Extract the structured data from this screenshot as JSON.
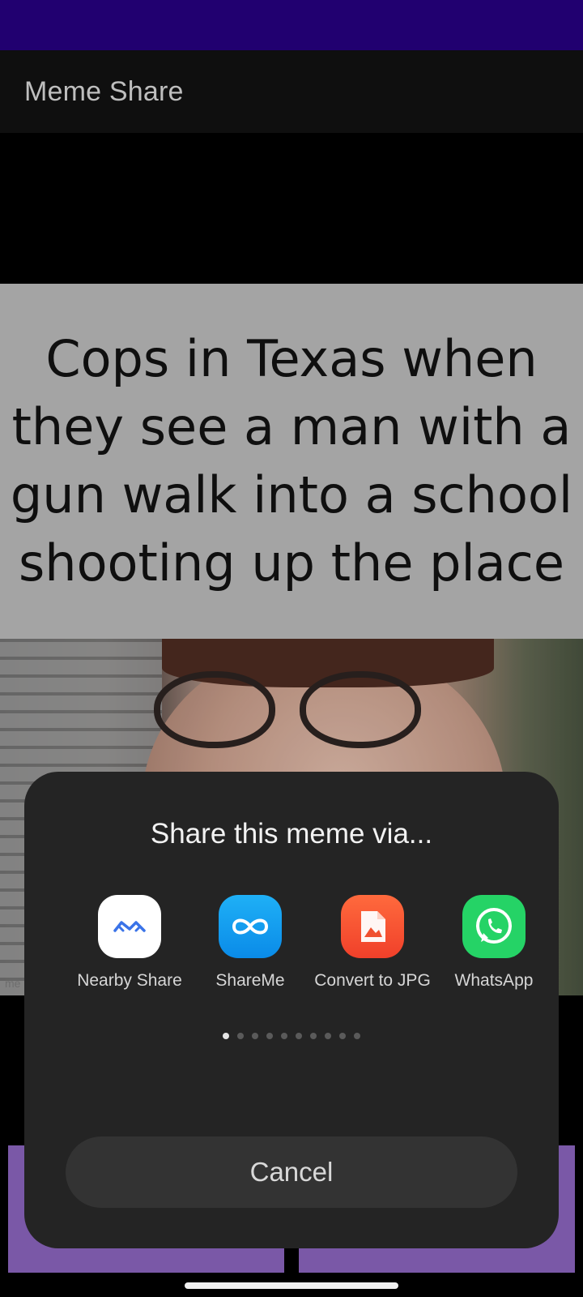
{
  "app": {
    "title": "Meme Share"
  },
  "meme": {
    "caption": "Cops in Texas when they see a man with a gun walk into a school shooting up the place",
    "watermark": "me"
  },
  "share_sheet": {
    "title": "Share this meme via...",
    "targets": [
      {
        "label": "Nearby Share",
        "icon": "nearby-share-icon",
        "color": "#ffffff"
      },
      {
        "label": "ShareMe",
        "icon": "shareme-icon",
        "color": "#1a9ff0"
      },
      {
        "label": "Convert to JPG",
        "icon": "convert-jpg-icon",
        "color": "#f5502f"
      },
      {
        "label": "WhatsApp",
        "icon": "whatsapp-icon",
        "color": "#25d366"
      }
    ],
    "page_indicator": {
      "current": 1,
      "total": 10
    },
    "cancel_label": "Cancel"
  },
  "colors": {
    "status_bar": "#24007a",
    "app_bar": "#111111",
    "sheet": "#242424",
    "button_accent": "#8560b6"
  }
}
